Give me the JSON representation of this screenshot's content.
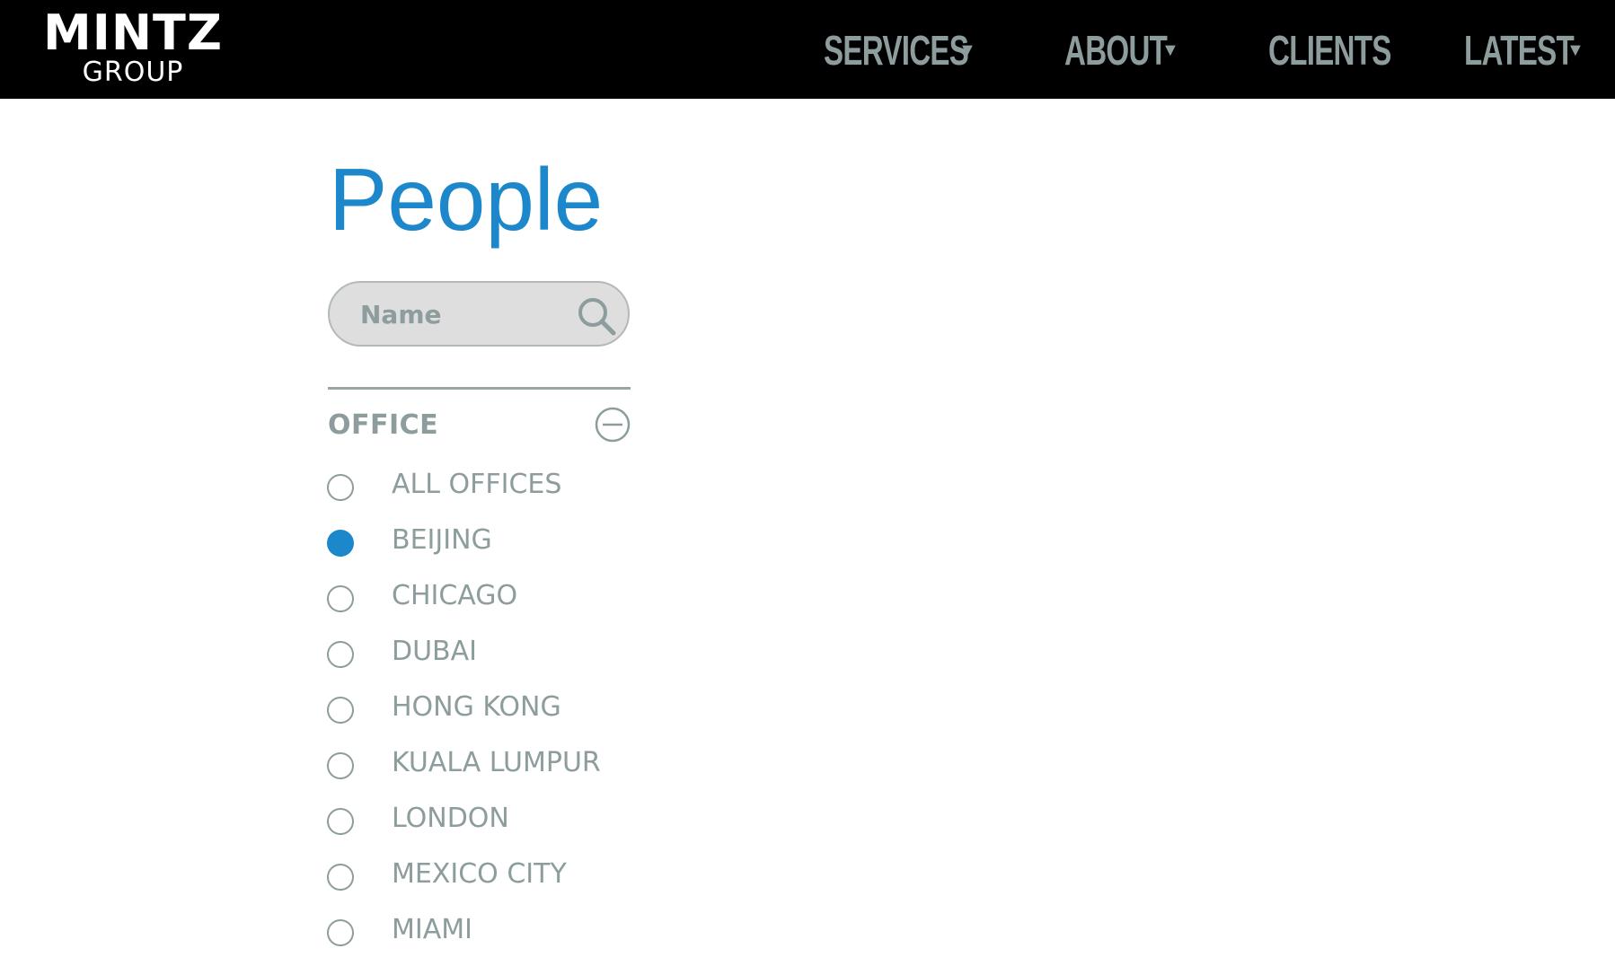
{
  "brand": {
    "name": "MINTZ",
    "sub": "GROUP"
  },
  "nav": {
    "items": [
      {
        "label": "SERVICES",
        "dropdown": true
      },
      {
        "label": "ABOUT",
        "dropdown": true
      },
      {
        "label": "CLIENTS",
        "dropdown": false
      },
      {
        "label": "LATEST",
        "dropdown": true
      }
    ],
    "caret": "▼"
  },
  "page": {
    "title": "People"
  },
  "search": {
    "placeholder": "Name",
    "value": "",
    "icon": "search-icon"
  },
  "filter": {
    "heading": "OFFICE",
    "collapse_icon": "minus-circle-icon",
    "selected": "BEIJING",
    "options": [
      "ALL OFFICES",
      "BEIJING",
      "CHICAGO",
      "DUBAI",
      "HONG KONG",
      "KUALA LUMPUR",
      "LONDON",
      "MEXICO CITY",
      "MIAMI"
    ]
  },
  "colors": {
    "header_bg": "#000000",
    "accent": "#1d87cc",
    "muted_text": "#8d9c9c",
    "search_bg": "#dedede"
  }
}
